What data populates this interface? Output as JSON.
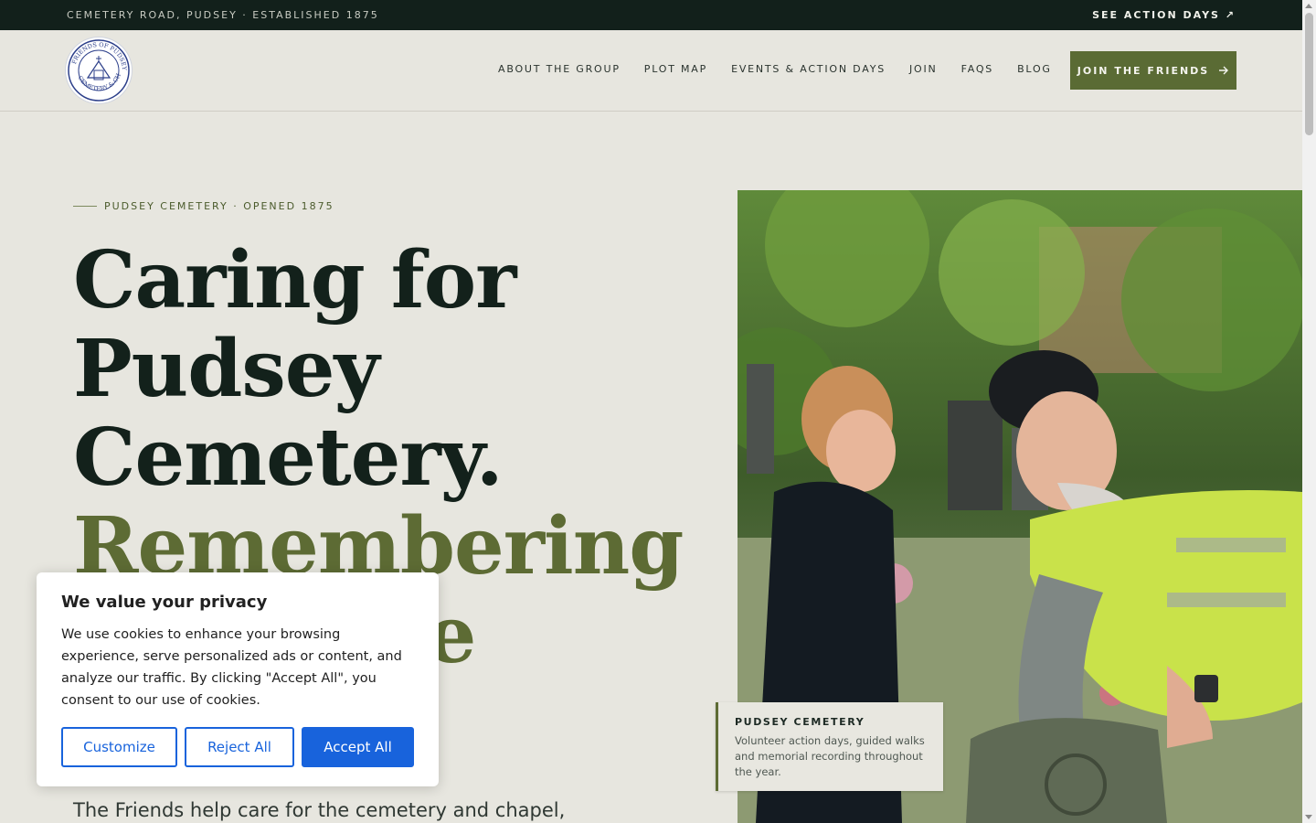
{
  "topbar": {
    "address": "CEMETERY ROAD, PUDSEY · ESTABLISHED 1875",
    "action_link": "SEE ACTION DAYS ↗"
  },
  "header": {
    "logo_text": "FRIENDS OF PUDSEY CEMETERY & CHAPEL",
    "nav": [
      "ABOUT THE GROUP",
      "PLOT MAP",
      "EVENTS & ACTION DAYS",
      "JOIN",
      "FAQS",
      "BLOG"
    ],
    "cta_label": "JOIN THE FRIENDS",
    "cta_icon": "arrow-right-icon"
  },
  "hero": {
    "eyebrow": "PUDSEY CEMETERY · OPENED 1875",
    "headline_lines": [
      "Caring for",
      "Pudsey",
      "Cemetery."
    ],
    "headline_green_lines": [
      "Remembering",
      "le"
    ],
    "lead": "The Friends help care for the cemetery and chapel,"
  },
  "photo_caption": {
    "title": "PUDSEY CEMETERY",
    "description": "Volunteer action days, guided walks and memorial recording throughout the year."
  },
  "cookie_banner": {
    "title": "We value your privacy",
    "message": "We use cookies to enhance your browsing experience, serve personalized ads or content, and analyze our traffic. By clicking \"Accept All\", you consent to our use of cookies.",
    "customize_label": "Customize",
    "reject_label": "Reject All",
    "accept_label": "Accept All"
  },
  "colors": {
    "topbar_bg": "#12201b",
    "page_bg": "#e7e6df",
    "accent_green": "#5a6b34",
    "cookie_blue": "#1863dc"
  }
}
